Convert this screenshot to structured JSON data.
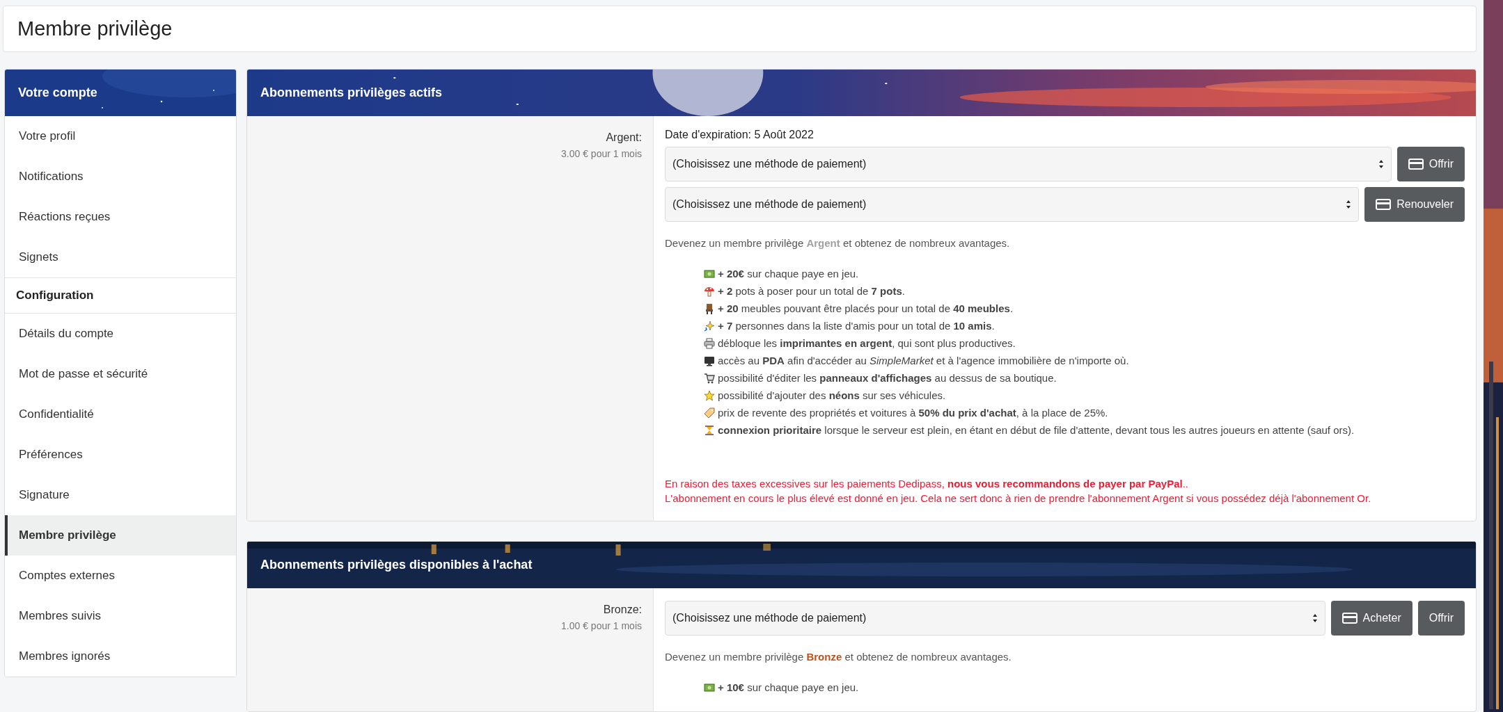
{
  "page_title": "Membre privilège",
  "sidebar": {
    "header": "Votre compte",
    "items": [
      {
        "kind": "link",
        "label": "Votre profil",
        "selected": false
      },
      {
        "kind": "link",
        "label": "Notifications",
        "selected": false
      },
      {
        "kind": "link",
        "label": "Réactions reçues",
        "selected": false
      },
      {
        "kind": "link",
        "label": "Signets",
        "selected": false
      },
      {
        "kind": "heading",
        "label": "Configuration"
      },
      {
        "kind": "link",
        "label": "Détails du compte",
        "selected": false
      },
      {
        "kind": "link",
        "label": "Mot de passe et sécurité",
        "selected": false
      },
      {
        "kind": "link",
        "label": "Confidentialité",
        "selected": false
      },
      {
        "kind": "link",
        "label": "Préférences",
        "selected": false
      },
      {
        "kind": "link",
        "label": "Signature",
        "selected": false
      },
      {
        "kind": "link",
        "label": "Membre privilège",
        "selected": true
      },
      {
        "kind": "link",
        "label": "Comptes externes",
        "selected": false
      },
      {
        "kind": "link",
        "label": "Membres suivis",
        "selected": false
      },
      {
        "kind": "link",
        "label": "Membres ignorés",
        "selected": false
      }
    ]
  },
  "panels": [
    {
      "title": "Abonnements privilèges actifs",
      "subscriptions": [
        {
          "name": "Argent:",
          "price": "3.00 € pour 1 mois",
          "expiry": "Date d'expiration: 5 Août 2022",
          "actions": [
            {
              "select": "(Choisissez une méthode de paiement)",
              "buttons": [
                {
                  "label": "Offrir",
                  "icon": true
                }
              ]
            },
            {
              "select": "(Choisissez une méthode de paiement)",
              "buttons": [
                {
                  "label": "Renouveler",
                  "icon": true
                }
              ]
            }
          ],
          "intro": {
            "before": "Devenez un membre privilège",
            "tier": "Argent",
            "color": "#a0a0a0",
            "after": "et obtenez de nombreux avantages."
          },
          "benefits": [
            {
              "kind": "money",
              "text": "**+ 20€** sur chaque paye en jeu."
            },
            {
              "kind": "mushroom",
              "text": "**+ 2** pots à poser pour un total de **7 pots**."
            },
            {
              "kind": "chair",
              "text": "**+ 20** meubles pouvant être placés pour un total de **40 meubles**."
            },
            {
              "kind": "sparkle",
              "text": "**+ 7** personnes dans la liste d'amis pour un total de **10 amis**."
            },
            {
              "kind": "printer",
              "text": "débloque les **imprimantes en argent**, qui sont plus productives."
            },
            {
              "kind": "monitor",
              "text": "accès au **PDA** afin d'accéder au *SimpleMarket* et à l'agence immobilière de n'importe où."
            },
            {
              "kind": "cart",
              "text": "possibilité d'éditer les **panneaux d'affichages** au dessus de sa boutique."
            },
            {
              "kind": "star",
              "text": "possibilité d'ajouter des **néons** sur ses véhicules."
            },
            {
              "kind": "tag",
              "text": "prix de revente des propriétés et voitures à **50% du prix d'achat**, à la place de 25%."
            },
            {
              "kind": "hourglass",
              "text": "**connexion prioritaire** lorsque le serveur est plein, en étant en début de file d'attente, devant tous les autres joueurs en attente (sauf ors)."
            }
          ],
          "notes": [
            "En raison des taxes excessives sur les paiements Dedipass, **nous vous recommandons de payer par PayPal**..",
            "L'abonnement en cours le plus élevé est donné en jeu. Cela ne sert donc à rien de prendre l'abonnement Argent si vous possédez déjà l'abonnement Or."
          ]
        }
      ]
    },
    {
      "title": "Abonnements privilèges disponibles à l'achat",
      "subscriptions": [
        {
          "name": "Bronze:",
          "price": "1.00 € pour 1 mois",
          "actions": [
            {
              "select": "(Choisissez une méthode de paiement)",
              "buttons": [
                {
                  "label": "Acheter",
                  "icon": true
                },
                {
                  "label": "Offrir",
                  "icon": false
                }
              ]
            }
          ],
          "intro": {
            "before": "Devenez un membre privilège",
            "tier": "Bronze",
            "color": "#c0501a",
            "after": "et obtenez de nombreux avantages."
          },
          "benefits": [
            {
              "kind": "money",
              "text": "**+ 10€** sur chaque paye en jeu."
            }
          ]
        }
      ]
    }
  ]
}
